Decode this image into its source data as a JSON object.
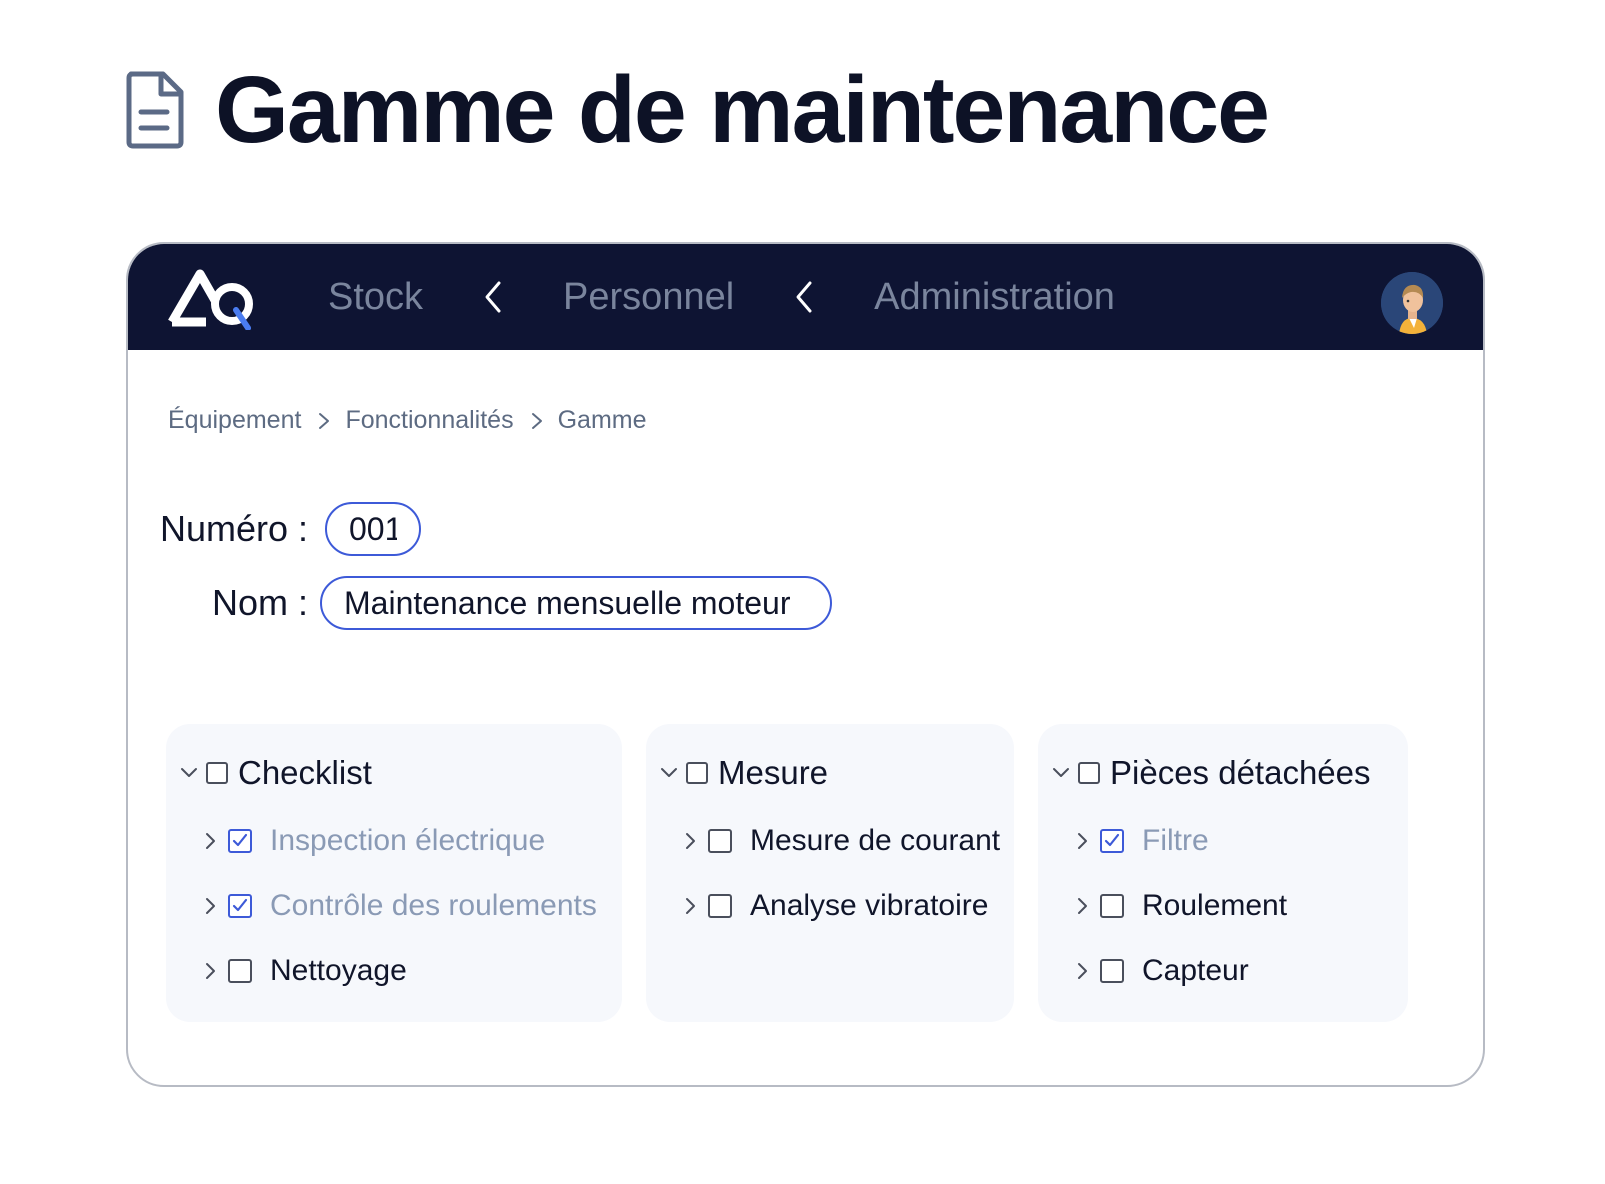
{
  "page": {
    "title": "Gamme de maintenance",
    "icon": "document-icon"
  },
  "topbar": {
    "background": "#0e1433",
    "logo": "aq-logo",
    "nav": [
      "Stock",
      "Personnel",
      "Administration"
    ],
    "separator_icon": "chevron-left-icon",
    "avatar": "user-avatar"
  },
  "breadcrumb": [
    "Équipement",
    "Fonctionnalités",
    "Gamme"
  ],
  "form": {
    "numero_label": "Numéro :",
    "numero_value": "001",
    "nom_label": "Nom :",
    "nom_value": "Maintenance mensuelle moteur"
  },
  "panels": [
    {
      "title": "Checklist",
      "checked": false,
      "items": [
        {
          "label": "Inspection électrique",
          "checked": true
        },
        {
          "label": "Contrôle des roulements",
          "checked": true
        },
        {
          "label": "Nettoyage",
          "checked": false
        }
      ]
    },
    {
      "title": "Mesure",
      "checked": false,
      "items": [
        {
          "label": "Mesure de courant",
          "checked": false
        },
        {
          "label": "Analyse vibratoire",
          "checked": false
        }
      ]
    },
    {
      "title": "Pièces détachées",
      "checked": false,
      "items": [
        {
          "label": "Filtre",
          "checked": true
        },
        {
          "label": "Roulement",
          "checked": false
        },
        {
          "label": "Capteur",
          "checked": false
        }
      ]
    }
  ],
  "colors": {
    "accent": "#3d5ad8",
    "checked_text": "#8a9ab5",
    "nav_text": "#7a859d"
  }
}
